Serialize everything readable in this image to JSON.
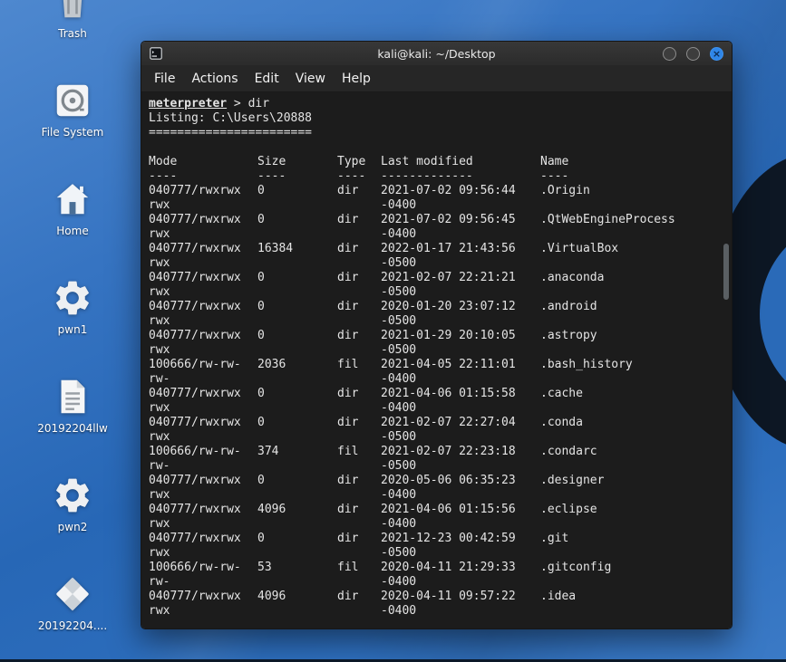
{
  "window": {
    "title": "kali@kali: ~/Desktop",
    "controls": {
      "close_glyph": "×"
    },
    "menu": [
      {
        "label": "File"
      },
      {
        "label": "Actions"
      },
      {
        "label": "Edit"
      },
      {
        "label": "View"
      },
      {
        "label": "Help"
      }
    ]
  },
  "terminal": {
    "prompt_user": "meterpreter",
    "prompt_rest": " > dir",
    "listing_title": "Listing: C:\\Users\\20888",
    "listing_rule": "=======================",
    "columns": [
      {
        "label": "Mode",
        "rule": "----"
      },
      {
        "label": "Size",
        "rule": "----"
      },
      {
        "label": "Type",
        "rule": "----"
      },
      {
        "label": "Last modified",
        "rule": "-------------"
      },
      {
        "label": "Name",
        "rule": "----"
      }
    ],
    "rows": [
      {
        "mode": "040777/rwxrwx",
        "mode_wrap": "rwx",
        "size": "0",
        "type": "dir",
        "modified": "2021-07-02 09:56:44",
        "tz": "-0400",
        "name": ".Origin"
      },
      {
        "mode": "040777/rwxrwx",
        "mode_wrap": "rwx",
        "size": "0",
        "type": "dir",
        "modified": "2021-07-02 09:56:45",
        "tz": "-0400",
        "name": ".QtWebEngineProcess"
      },
      {
        "mode": "040777/rwxrwx",
        "mode_wrap": "rwx",
        "size": "16384",
        "type": "dir",
        "modified": "2022-01-17 21:43:56",
        "tz": "-0500",
        "name": ".VirtualBox"
      },
      {
        "mode": "040777/rwxrwx",
        "mode_wrap": "rwx",
        "size": "0",
        "type": "dir",
        "modified": "2021-02-07 22:21:21",
        "tz": "-0500",
        "name": ".anaconda"
      },
      {
        "mode": "040777/rwxrwx",
        "mode_wrap": "rwx",
        "size": "0",
        "type": "dir",
        "modified": "2020-01-20 23:07:12",
        "tz": "-0500",
        "name": ".android"
      },
      {
        "mode": "040777/rwxrwx",
        "mode_wrap": "rwx",
        "size": "0",
        "type": "dir",
        "modified": "2021-01-29 20:10:05",
        "tz": "-0500",
        "name": ".astropy"
      },
      {
        "mode": "100666/rw-rw-",
        "mode_wrap": "rw-",
        "size": "2036",
        "type": "fil",
        "modified": "2021-04-05 22:11:01",
        "tz": "-0400",
        "name": ".bash_history"
      },
      {
        "mode": "040777/rwxrwx",
        "mode_wrap": "rwx",
        "size": "0",
        "type": "dir",
        "modified": "2021-04-06 01:15:58",
        "tz": "-0400",
        "name": ".cache"
      },
      {
        "mode": "040777/rwxrwx",
        "mode_wrap": "rwx",
        "size": "0",
        "type": "dir",
        "modified": "2021-02-07 22:27:04",
        "tz": "-0500",
        "name": ".conda"
      },
      {
        "mode": "100666/rw-rw-",
        "mode_wrap": "rw-",
        "size": "374",
        "type": "fil",
        "modified": "2021-02-07 22:23:18",
        "tz": "-0500",
        "name": ".condarc"
      },
      {
        "mode": "040777/rwxrwx",
        "mode_wrap": "rwx",
        "size": "0",
        "type": "dir",
        "modified": "2020-05-06 06:35:23",
        "tz": "-0400",
        "name": ".designer"
      },
      {
        "mode": "040777/rwxrwx",
        "mode_wrap": "rwx",
        "size": "4096",
        "type": "dir",
        "modified": "2021-04-06 01:15:56",
        "tz": "-0400",
        "name": ".eclipse"
      },
      {
        "mode": "040777/rwxrwx",
        "mode_wrap": "rwx",
        "size": "0",
        "type": "dir",
        "modified": "2021-12-23 00:42:59",
        "tz": "-0500",
        "name": ".git"
      },
      {
        "mode": "100666/rw-rw-",
        "mode_wrap": "rw-",
        "size": "53",
        "type": "fil",
        "modified": "2020-04-11 21:29:33",
        "tz": "-0400",
        "name": ".gitconfig"
      },
      {
        "mode": "040777/rwxrwx",
        "mode_wrap": "rwx",
        "size": "4096",
        "type": "dir",
        "modified": "2020-04-11 09:57:22",
        "tz": "-0400",
        "name": ".idea"
      }
    ]
  },
  "desktop": {
    "icons": [
      {
        "id": "trash",
        "label": "Trash",
        "glyph": "trash"
      },
      {
        "id": "file-system",
        "label": "File System",
        "glyph": "drive"
      },
      {
        "id": "home",
        "label": "Home",
        "glyph": "home"
      },
      {
        "id": "pwn1",
        "label": "pwn1",
        "glyph": "gear"
      },
      {
        "id": "20192204llw",
        "label": "20192204llw",
        "glyph": "document"
      },
      {
        "id": "pwn2",
        "label": "pwn2",
        "glyph": "gear"
      },
      {
        "id": "20192204",
        "label": "20192204....",
        "glyph": "package"
      }
    ]
  },
  "colors": {
    "close_button": "#2f86e8",
    "terminal_background": "#1c1c1c",
    "terminal_text": "#e4e4e4",
    "wallpaper_top": "#4e88cf",
    "wallpaper_bottom": "#2767b6"
  }
}
